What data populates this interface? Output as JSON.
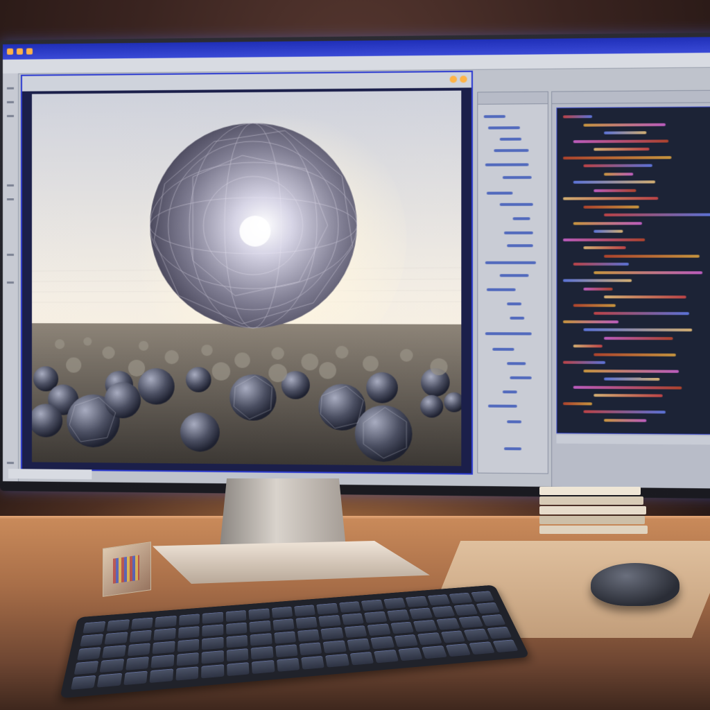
{
  "window": {
    "title": "",
    "menu": [],
    "viewport_title": "",
    "footer": ""
  },
  "panels": {
    "outliner_title": "",
    "code_title": "",
    "code_status": ""
  },
  "colors": {
    "title_bar": "#1f2fb8",
    "window_accent": "#2b3ad0",
    "code_background": "#1c2336",
    "desk_wood": "#a86e48",
    "lamp_glow": "#ffaa5a"
  },
  "icons": [
    "window-control-icon",
    "minimize-icon",
    "close-icon"
  ]
}
